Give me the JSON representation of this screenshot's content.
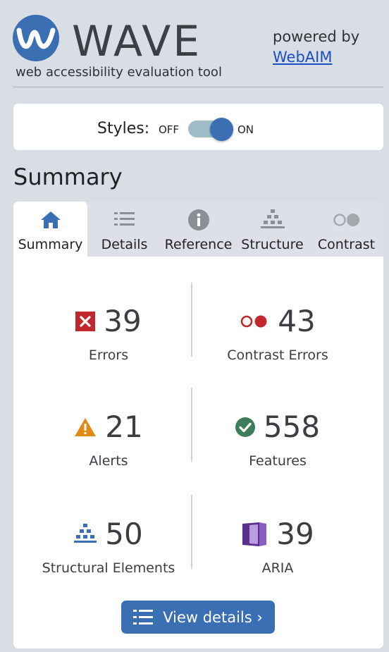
{
  "header": {
    "logo_text": "WAVE",
    "tagline": "web accessibility evaluation tool",
    "powered_by": "powered by",
    "webaim_link": "WebAIM"
  },
  "styles": {
    "label": "Styles:",
    "off": "OFF",
    "on": "ON",
    "state": "on"
  },
  "summary_heading": "Summary",
  "tabs": [
    {
      "label": "Summary",
      "icon": "home-icon",
      "active": true
    },
    {
      "label": "Details",
      "icon": "list-icon",
      "active": false
    },
    {
      "label": "Reference",
      "icon": "info-icon",
      "active": false
    },
    {
      "label": "Structure",
      "icon": "structure-icon",
      "active": false
    },
    {
      "label": "Contrast",
      "icon": "contrast-icon",
      "active": false
    }
  ],
  "stats": {
    "errors": {
      "value": "39",
      "label": "Errors",
      "icon": "error-icon"
    },
    "contrast_errors": {
      "value": "43",
      "label": "Contrast Errors",
      "icon": "contrast-error-icon"
    },
    "alerts": {
      "value": "21",
      "label": "Alerts",
      "icon": "alert-icon"
    },
    "features": {
      "value": "558",
      "label": "Features",
      "icon": "feature-icon"
    },
    "structural": {
      "value": "50",
      "label": "Structural Elements",
      "icon": "structure-icon"
    },
    "aria": {
      "value": "39",
      "label": "ARIA",
      "icon": "aria-icon"
    }
  },
  "view_details": "View details ›",
  "colors": {
    "brand_blue": "#3a6fb4",
    "error_red": "#c0282d",
    "alert_orange": "#e08a14",
    "feature_green": "#3d7d5c",
    "aria_purple": "#5a2f8e"
  }
}
